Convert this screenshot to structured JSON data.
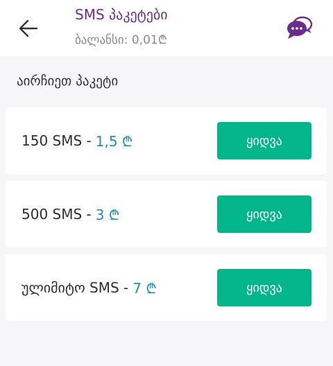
{
  "header": {
    "title": "SMS პაკეტები",
    "balance": "ბალანსი: 0,01₾"
  },
  "section": {
    "title": "აირჩიეთ პაკეტი"
  },
  "packages": [
    {
      "name": "150 SMS -",
      "price": "1,5 ₾",
      "buy_label": "ყიდვა"
    },
    {
      "name": "500 SMS -",
      "price": "3 ₾",
      "buy_label": "ყიდვა"
    },
    {
      "name": "ულიმიტო SMS -",
      "price": "7 ₾",
      "buy_label": "ყიდვა"
    }
  ],
  "icons": {
    "back": "arrow-left-icon",
    "chat": "chat-bubbles-icon"
  },
  "colors": {
    "title": "#6c2b8f",
    "price": "#1d8fb0",
    "buy_button": "#03b58b",
    "chat_icon": "#6c2b8f"
  }
}
